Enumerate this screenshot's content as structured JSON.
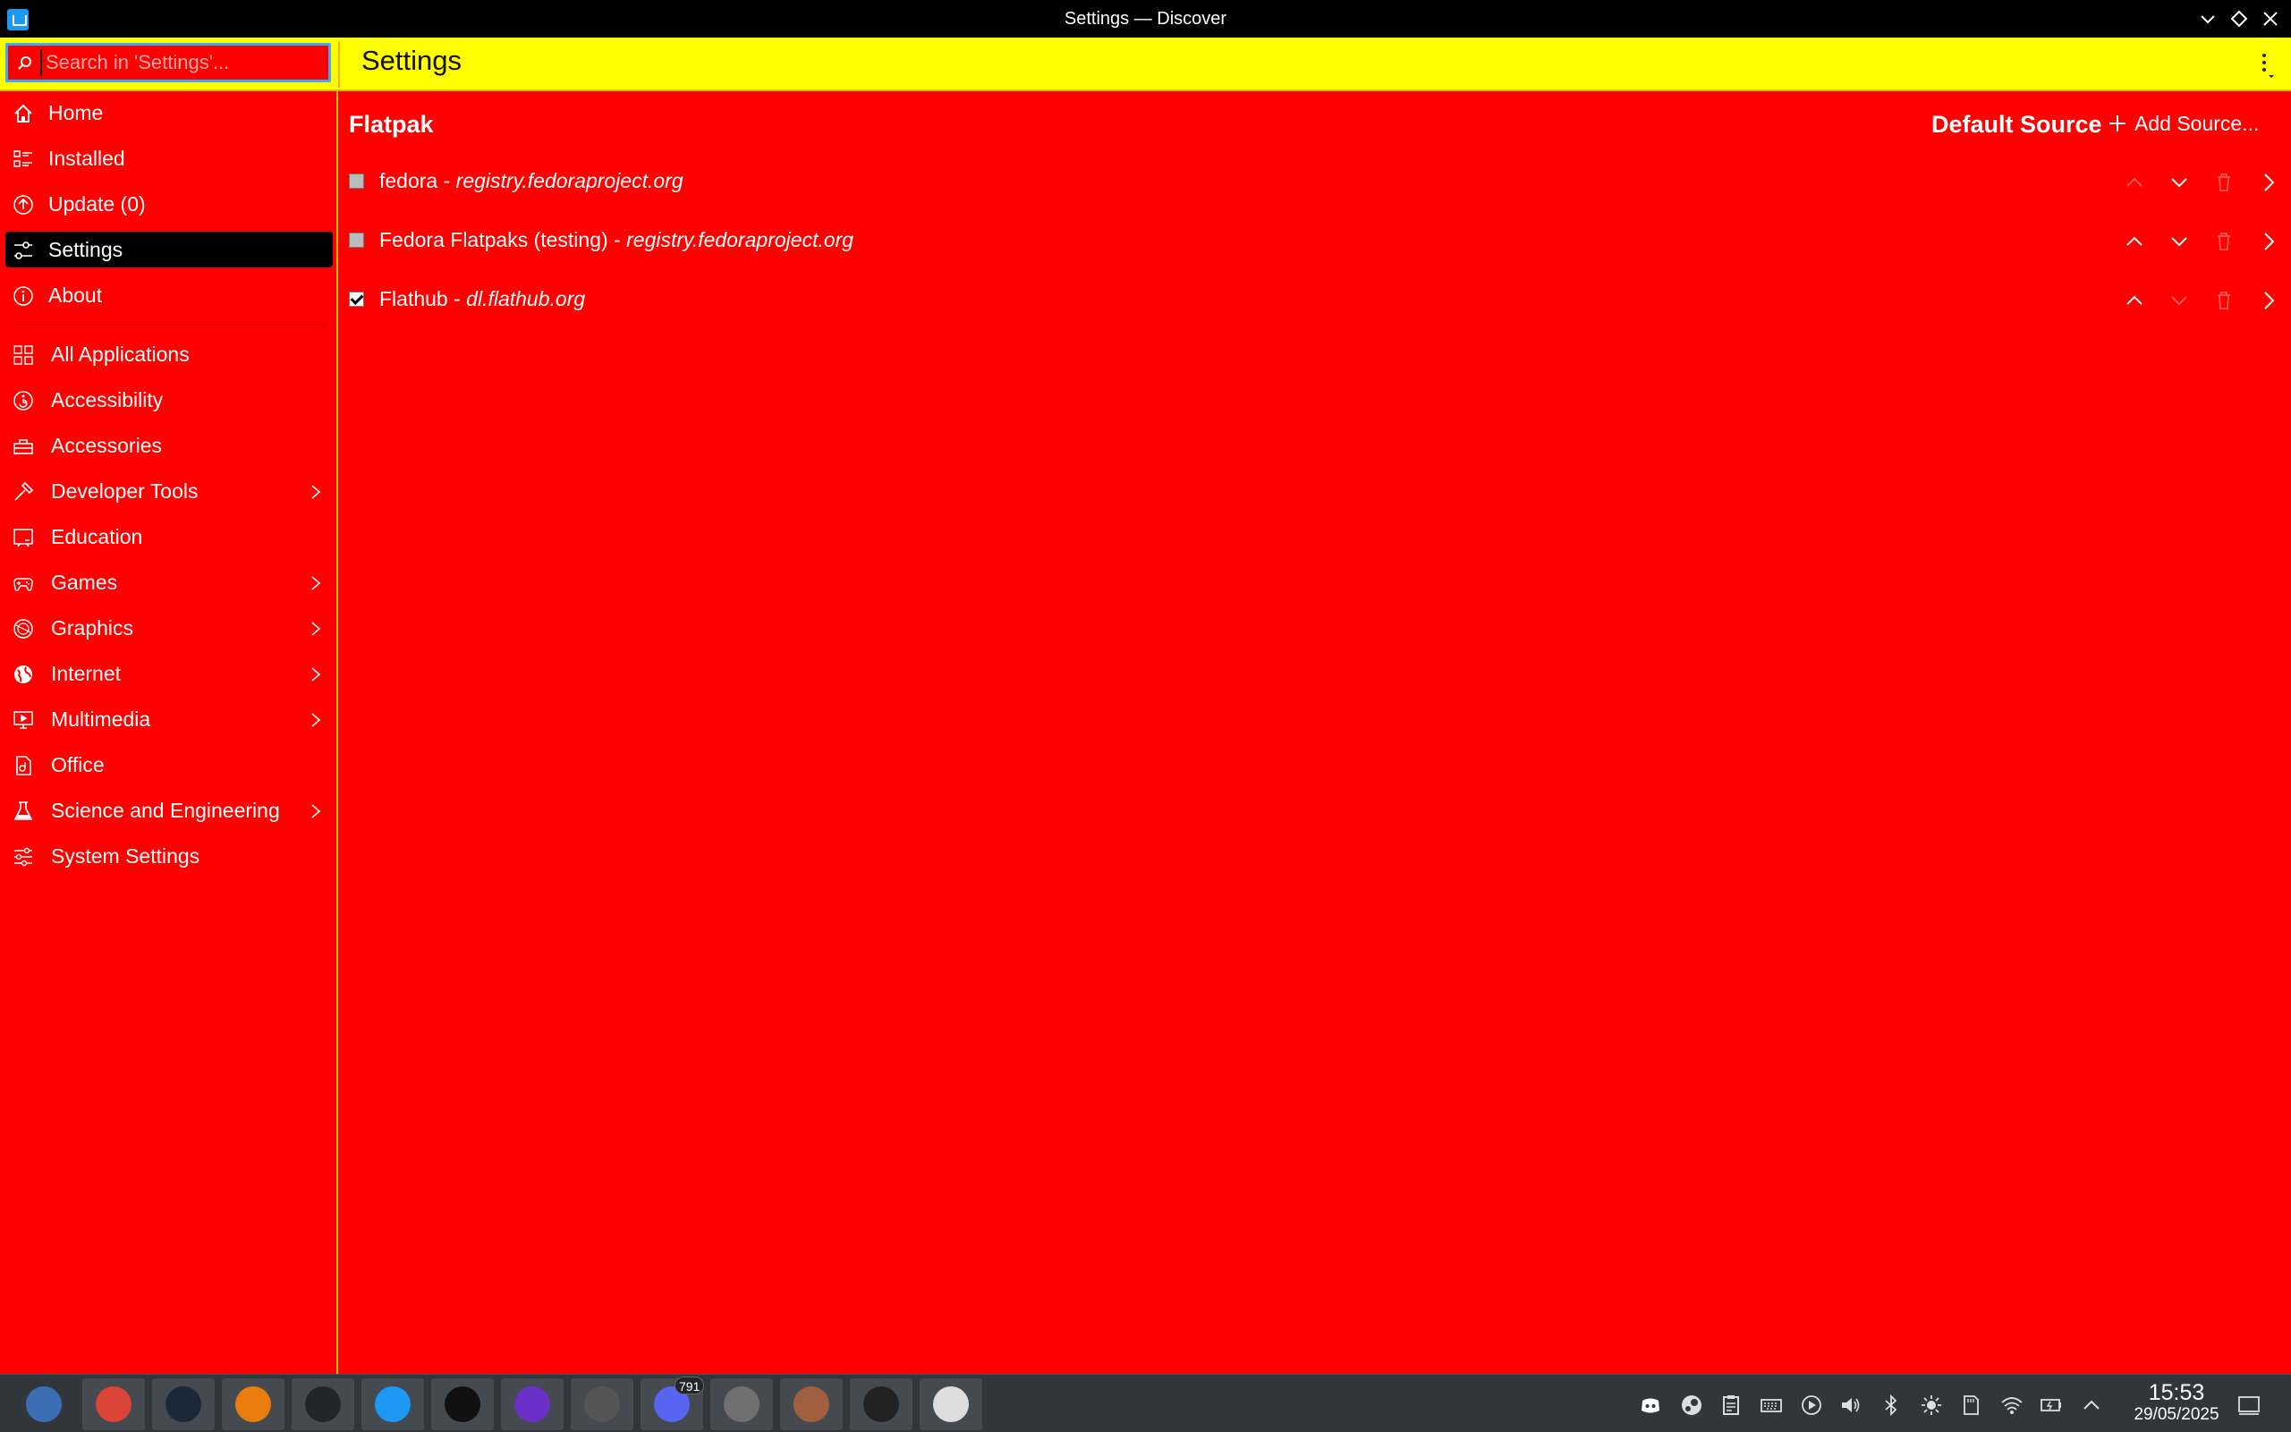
{
  "window": {
    "title": "Settings — Discover"
  },
  "header": {
    "search_placeholder": "Search in 'Settings'...",
    "page_title": "Settings"
  },
  "sidebar": {
    "nav": [
      {
        "label": "Home",
        "icon": "home-icon"
      },
      {
        "label": "Installed",
        "icon": "installed-list-icon"
      },
      {
        "label": "Update (0)",
        "icon": "update-icon"
      },
      {
        "label": "Settings",
        "icon": "settings-sliders-icon",
        "active": true
      },
      {
        "label": "About",
        "icon": "info-icon"
      }
    ],
    "categories": [
      {
        "label": "All Applications",
        "icon": "grid-icon",
        "has_children": false
      },
      {
        "label": "Accessibility",
        "icon": "accessibility-icon",
        "has_children": false
      },
      {
        "label": "Accessories",
        "icon": "toolbox-icon",
        "has_children": false
      },
      {
        "label": "Developer Tools",
        "icon": "hammer-icon",
        "has_children": true
      },
      {
        "label": "Education",
        "icon": "blackboard-icon",
        "has_children": false
      },
      {
        "label": "Games",
        "icon": "gamepad-icon",
        "has_children": true
      },
      {
        "label": "Graphics",
        "icon": "graphics-icon",
        "has_children": true
      },
      {
        "label": "Internet",
        "icon": "globe-icon",
        "has_children": true
      },
      {
        "label": "Multimedia",
        "icon": "multimedia-icon",
        "has_children": true
      },
      {
        "label": "Office",
        "icon": "office-icon",
        "has_children": false
      },
      {
        "label": "Science and Engineering",
        "icon": "flask-icon",
        "has_children": true
      },
      {
        "label": "System Settings",
        "icon": "system-settings-icon",
        "has_children": false
      }
    ]
  },
  "main": {
    "section_title": "Flatpak",
    "default_source_label": "Default Source",
    "add_source_label": "Add Source...",
    "sources": [
      {
        "name": "fedora",
        "separator": " - ",
        "url": "registry.fedoraproject.org",
        "checked": false,
        "up_enabled": false,
        "down_enabled": true,
        "delete_enabled": false
      },
      {
        "name": "Fedora Flatpaks (testing)",
        "separator": " - ",
        "url": "registry.fedoraproject.org",
        "checked": false,
        "up_enabled": true,
        "down_enabled": true,
        "delete_enabled": false
      },
      {
        "name": "Flathub",
        "separator": " - ",
        "url": "dl.flathub.org",
        "checked": true,
        "up_enabled": true,
        "down_enabled": false,
        "delete_enabled": false
      }
    ]
  },
  "taskbar": {
    "apps": [
      {
        "name": "fedora-launcher-icon",
        "color": "#3c6eb4"
      },
      {
        "name": "chrome-icon",
        "color": "#db4437"
      },
      {
        "name": "steam-icon",
        "color": "#1b2838"
      },
      {
        "name": "blender-icon",
        "color": "#e87d0d"
      },
      {
        "name": "terminal-icon",
        "color": "#232629"
      },
      {
        "name": "discover-icon",
        "color": "#1d99f3"
      },
      {
        "name": "file-manager-icon",
        "color": "#111111"
      },
      {
        "name": "f-app-icon",
        "color": "#6a30c8"
      },
      {
        "name": "vm-manager-icon",
        "color": "#555555"
      },
      {
        "name": "discord-icon",
        "color": "#5865f2",
        "badge": "791"
      },
      {
        "name": "flatseal-icon",
        "color": "#707070"
      },
      {
        "name": "image-app-icon",
        "color": "#a06040"
      },
      {
        "name": "console-icon",
        "color": "#222222"
      },
      {
        "name": "archive-icon",
        "color": "#dddddd"
      }
    ],
    "clock_time": "15:53",
    "clock_date": "29/05/2025"
  },
  "colors": {
    "accent": "#3daee9",
    "sidebar_bg": "#ff0000",
    "header_bg": "#ffff00",
    "taskbar_bg": "#31363b"
  }
}
